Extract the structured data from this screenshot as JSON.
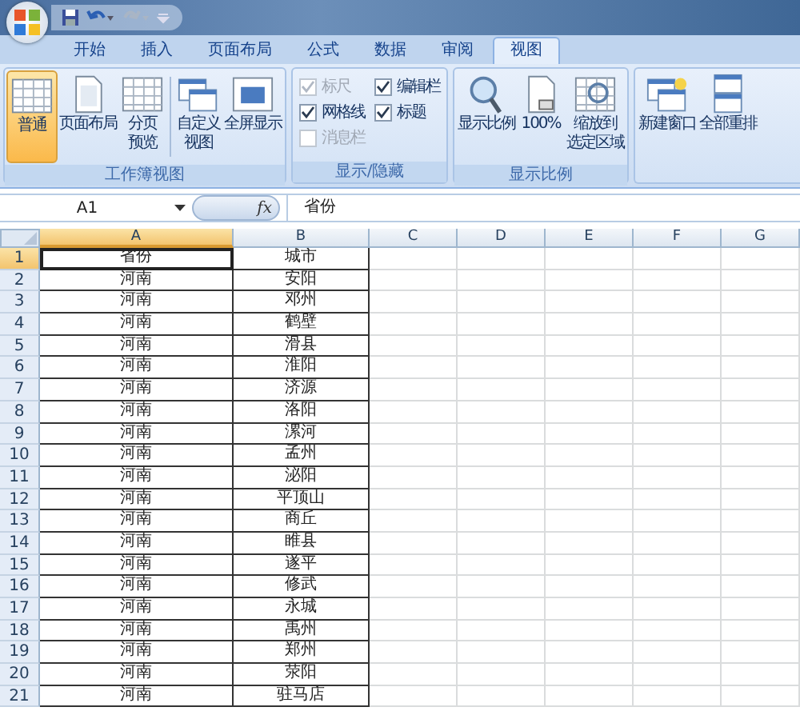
{
  "tabs": [
    {
      "label": "开始",
      "selected": false
    },
    {
      "label": "插入",
      "selected": false
    },
    {
      "label": "页面布局",
      "selected": false
    },
    {
      "label": "公式",
      "selected": false
    },
    {
      "label": "数据",
      "selected": false
    },
    {
      "label": "审阅",
      "selected": false
    },
    {
      "label": "视图",
      "selected": true
    }
  ],
  "ribbon_groups": [
    {
      "label": "工作簿视图",
      "items": [
        {
          "kind": "large",
          "label_lines": [
            "普通"
          ],
          "selected": true
        },
        {
          "kind": "large",
          "label_lines": [
            "页面布局"
          ],
          "selected": false
        },
        {
          "kind": "large",
          "label_lines": [
            "分页",
            "预览"
          ],
          "selected": false
        },
        {
          "kind": "separator"
        },
        {
          "kind": "large",
          "label_lines": [
            "自定义",
            "视图"
          ],
          "selected": false
        },
        {
          "kind": "large",
          "label_lines": [
            "全屏显示"
          ],
          "selected": false
        }
      ]
    },
    {
      "label": "显示/隐藏",
      "items": [
        {
          "kind": "checkbox",
          "label": "标尺",
          "checked": true,
          "disabled": true
        },
        {
          "kind": "checkbox",
          "label": "编辑栏",
          "checked": true,
          "disabled": false
        },
        {
          "kind": "checkbox",
          "label": "网格线",
          "checked": true,
          "disabled": false
        },
        {
          "kind": "checkbox",
          "label": "标题",
          "checked": true,
          "disabled": false
        },
        {
          "kind": "checkbox",
          "label": "消息栏",
          "checked": false,
          "disabled": true
        }
      ]
    },
    {
      "label": "显示比例",
      "items": [
        {
          "kind": "large",
          "label_lines": [
            "显示比例"
          ],
          "selected": false
        },
        {
          "kind": "large",
          "label_lines": [
            "100%"
          ],
          "selected": false
        },
        {
          "kind": "large",
          "label_lines": [
            "缩放到",
            "选定区域"
          ],
          "selected": false
        }
      ]
    },
    {
      "items": [
        {
          "kind": "large",
          "label_lines": [
            "新建窗口"
          ],
          "selected": false
        },
        {
          "kind": "large",
          "label_lines": [
            "全部重排"
          ],
          "selected": false
        }
      ]
    }
  ],
  "formula_bar": {
    "name_box": "A1",
    "function_label": "fx",
    "value": "省份"
  },
  "sheet": {
    "columns": [
      {
        "label": "A",
        "selected": true
      },
      {
        "label": "B",
        "selected": false
      },
      {
        "label": "C",
        "selected": false
      },
      {
        "label": "D",
        "selected": false
      },
      {
        "label": "E",
        "selected": false
      },
      {
        "label": "F",
        "selected": false
      },
      {
        "label": "G",
        "selected": false
      }
    ],
    "rows": [
      {
        "number": "1",
        "selected": true,
        "cells": [
          "省份",
          "城市"
        ]
      },
      {
        "number": "2",
        "selected": false,
        "cells": [
          "河南",
          "安阳"
        ]
      },
      {
        "number": "3",
        "selected": false,
        "cells": [
          "河南",
          "邓州"
        ]
      },
      {
        "number": "4",
        "selected": false,
        "cells": [
          "河南",
          "鹤壁"
        ]
      },
      {
        "number": "5",
        "selected": false,
        "cells": [
          "河南",
          "滑县"
        ]
      },
      {
        "number": "6",
        "selected": false,
        "cells": [
          "河南",
          "淮阳"
        ]
      },
      {
        "number": "7",
        "selected": false,
        "cells": [
          "河南",
          "济源"
        ]
      },
      {
        "number": "8",
        "selected": false,
        "cells": [
          "河南",
          "洛阳"
        ]
      },
      {
        "number": "9",
        "selected": false,
        "cells": [
          "河南",
          "漯河"
        ]
      },
      {
        "number": "10",
        "selected": false,
        "cells": [
          "河南",
          "孟州"
        ]
      },
      {
        "number": "11",
        "selected": false,
        "cells": [
          "河南",
          "泌阳"
        ]
      },
      {
        "number": "12",
        "selected": false,
        "cells": [
          "河南",
          "平顶山"
        ]
      },
      {
        "number": "13",
        "selected": false,
        "cells": [
          "河南",
          "商丘"
        ]
      },
      {
        "number": "14",
        "selected": false,
        "cells": [
          "河南",
          "睢县"
        ]
      },
      {
        "number": "15",
        "selected": false,
        "cells": [
          "河南",
          "遂平"
        ]
      },
      {
        "number": "16",
        "selected": false,
        "cells": [
          "河南",
          "修武"
        ]
      },
      {
        "number": "17",
        "selected": false,
        "cells": [
          "河南",
          "永城"
        ]
      },
      {
        "number": "18",
        "selected": false,
        "cells": [
          "河南",
          "禹州"
        ]
      },
      {
        "number": "19",
        "selected": false,
        "cells": [
          "河南",
          "郑州"
        ]
      },
      {
        "number": "20",
        "selected": false,
        "cells": [
          "河南",
          "荥阳"
        ]
      },
      {
        "number": "21",
        "selected": false,
        "cells": [
          "河南",
          "驻马店"
        ]
      }
    ]
  }
}
